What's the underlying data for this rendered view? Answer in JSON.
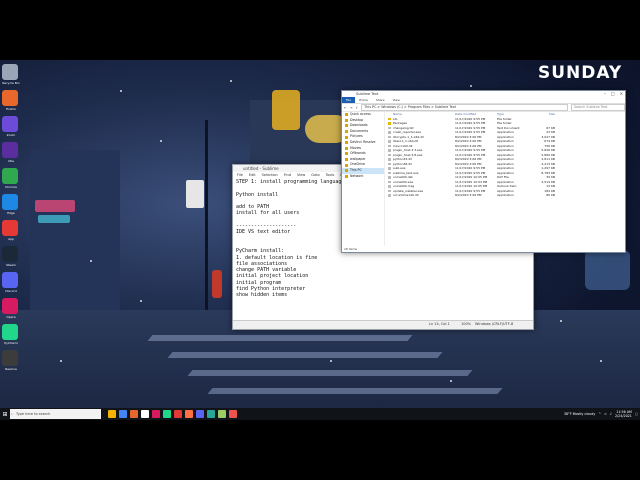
{
  "brand": "SUNDAY",
  "sublime": {
    "title": "untitled - Sublime",
    "menu": [
      "File",
      "Edit",
      "Selection",
      "Find",
      "View",
      "Goto",
      "Tools",
      "Project",
      "Preferences",
      "Help"
    ],
    "lines": [
      "STEP 1: install programming language",
      "",
      "Python install",
      "",
      "add to PATH",
      "install for all users",
      "",
      "--------------------",
      "IDE VS text editor",
      "",
      "",
      "PyCharm install:",
      "1. default location is fine",
      "file associations",
      "change PATH variable",
      "initial project location",
      "initial program",
      "find Python interpreter",
      "show hidden items"
    ],
    "status": {
      "position": "Ln 14, Col 1",
      "zoom": "100%",
      "line_ending": "Windows (CRLF)",
      "encoding": "UTF-8"
    }
  },
  "explorer": {
    "title": "Sublime Text",
    "ribbon": [
      "File",
      "Home",
      "Share",
      "View"
    ],
    "path": "This PC > Windows (C:) > Program Files > Sublime Text",
    "search_placeholder": "Search Sublime Text",
    "nav": [
      {
        "label": "Quick access",
        "sel": false
      },
      {
        "label": "Desktop",
        "sel": false
      },
      {
        "label": "Downloads",
        "sel": false
      },
      {
        "label": "Documents",
        "sel": false
      },
      {
        "label": "Pictures",
        "sel": false
      },
      {
        "label": "DaVinci Resolve",
        "sel": false
      },
      {
        "label": "Movies",
        "sel": false
      },
      {
        "label": "Offbrands",
        "sel": false
      },
      {
        "label": "wallpaper",
        "sel": false
      },
      {
        "label": "OneDrive",
        "sel": false
      },
      {
        "label": "This PC",
        "sel": true
      },
      {
        "label": "Network",
        "sel": false
      }
    ],
    "columns": [
      "Name",
      "Date modified",
      "Type",
      "Size"
    ],
    "files": [
      {
        "name": "Lib",
        "date": "11/17/2020 9:55 PM",
        "type": "File folder",
        "size": "",
        "folder": true
      },
      {
        "name": "Packages",
        "date": "11/17/2020 9:55 PM",
        "type": "File folder",
        "size": "",
        "folder": true
      },
      {
        "name": "changelog.txt",
        "date": "11/17/2020 9:55 PM",
        "type": "Text Document",
        "size": "67 KB",
        "folder": false
      },
      {
        "name": "crash_reporter.exe",
        "date": "11/17/2020 9:55 PM",
        "type": "Application",
        "size": "23 KB",
        "folder": false
      },
      {
        "name": "libcrypto-1_1-x64.dll",
        "date": "8/2/2020 3:06 PM",
        "type": "Application",
        "size": "3,027 KB",
        "folder": false
      },
      {
        "name": "libssl-1_1-x64.dll",
        "date": "8/2/2020 3:06 PM",
        "type": "Application",
        "size": "674 KB",
        "folder": false
      },
      {
        "name": "msvcr100.dll",
        "date": "8/2/2020 3:06 PM",
        "type": "Application",
        "size": "756 KB",
        "folder": false
      },
      {
        "name": "plugin_host-3.3.exe",
        "date": "11/17/2020 9:55 PM",
        "type": "Application",
        "size": "5,826 KB",
        "folder": false
      },
      {
        "name": "plugin_host-3.8.exe",
        "date": "11/17/2020 9:55 PM",
        "type": "Application",
        "size": "5,869 KB",
        "folder": false
      },
      {
        "name": "python33.dll",
        "date": "8/2/2020 3:06 PM",
        "type": "Application",
        "size": "2,811 KB",
        "folder": false
      },
      {
        "name": "python38.dll",
        "date": "8/2/2020 3:06 PM",
        "type": "Application",
        "size": "4,213 KB",
        "folder": false
      },
      {
        "name": "subl.exe",
        "date": "11/17/2020 9:55 PM",
        "type": "Application",
        "size": "1,297 KB",
        "folder": false
      },
      {
        "name": "sublime_text.exe",
        "date": "11/17/2020 9:55 PM",
        "type": "Application",
        "size": "8,783 KB",
        "folder": false
      },
      {
        "name": "unins000.dat",
        "date": "11/17/2020 10:05 PM",
        "type": "DAT File",
        "size": "39 KB",
        "folder": false
      },
      {
        "name": "unins000.exe",
        "date": "11/17/2020 10:04 PM",
        "type": "Application",
        "size": "2,514 KB",
        "folder": false
      },
      {
        "name": "unins000.msg",
        "date": "11/17/2020 10:05 PM",
        "type": "Outlook Item",
        "size": "13 KB",
        "folder": false
      },
      {
        "name": "update_installer.exe",
        "date": "11/17/2020 9:55 PM",
        "type": "Application",
        "size": "184 KB",
        "folder": false
      },
      {
        "name": "vcruntime140.dll",
        "date": "8/2/2020 3:06 PM",
        "type": "Application",
        "size": "86 KB",
        "folder": false
      }
    ],
    "item_count": "18 items"
  },
  "desktop_icons": [
    {
      "label": "Recycle Bin",
      "color": "#9aa6b8"
    },
    {
      "label": "Firefox",
      "color": "#e8672a"
    },
    {
      "label": "Zoom",
      "color": "#6b4bd8"
    },
    {
      "label": "Obs",
      "color": "#5b2ea0"
    },
    {
      "label": "Chrome",
      "color": "#2fa84f"
    },
    {
      "label": "Edge",
      "color": "#1e88e5"
    },
    {
      "label": "App",
      "color": "#e53935"
    },
    {
      "label": "Steam",
      "color": "#1b2838"
    },
    {
      "label": "Discord",
      "color": "#5865f2"
    },
    {
      "label": "Opera",
      "color": "#d81b60"
    },
    {
      "label": "PyCharm",
      "color": "#21d789"
    },
    {
      "label": "Resolve",
      "color": "#3c3c3c"
    }
  ],
  "taskbar": {
    "search_placeholder": "Type here to search",
    "apps": [
      "#f4b400",
      "#4285f4",
      "#e8672a",
      "#ffffff",
      "#d81b60",
      "#21d789",
      "#e53935",
      "#ff7043",
      "#5865f2",
      "#26a69a",
      "#9ccc65",
      "#ef5350"
    ],
    "weather": "38°F  Mostly cloudy",
    "time": "11:56 AM",
    "date": "2/24/2021"
  }
}
